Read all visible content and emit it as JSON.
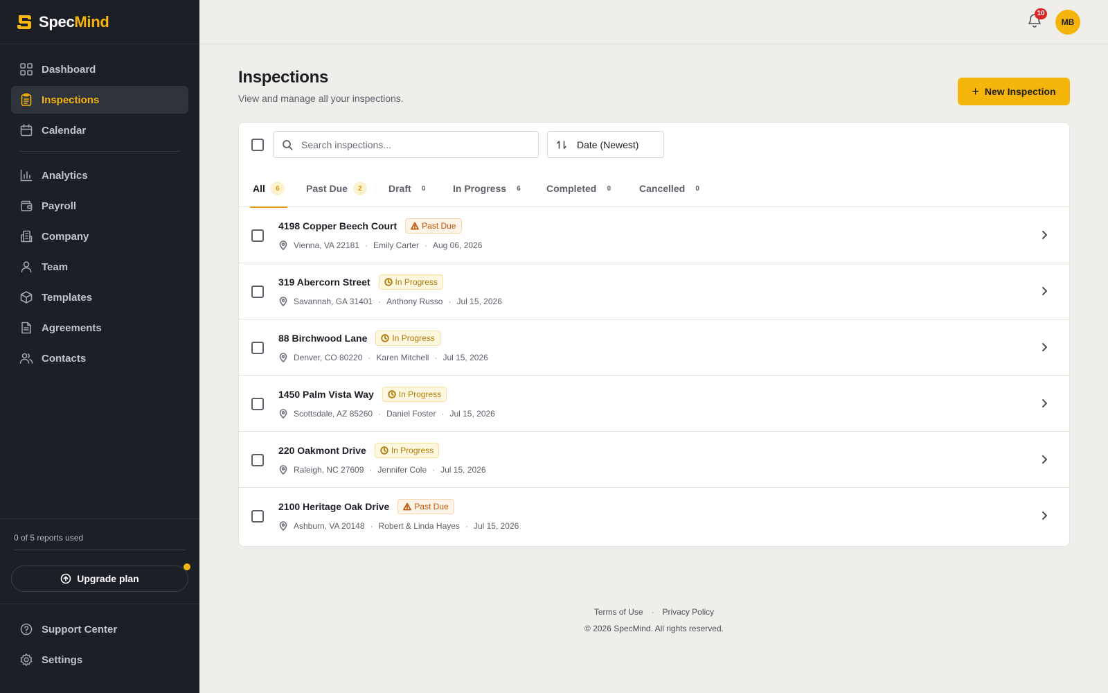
{
  "brand": {
    "name_part1": "Spec",
    "name_part2": "Mind",
    "accent": "#f5b50a"
  },
  "sidebar": {
    "nav_primary": [
      {
        "label": "Dashboard",
        "icon": "grid-icon"
      },
      {
        "label": "Inspections",
        "icon": "clipboard-icon",
        "active": true
      },
      {
        "label": "Calendar",
        "icon": "calendar-icon"
      }
    ],
    "nav_secondary": [
      {
        "label": "Analytics",
        "icon": "bar-chart-icon"
      },
      {
        "label": "Payroll",
        "icon": "wallet-icon"
      },
      {
        "label": "Company",
        "icon": "building-icon"
      },
      {
        "label": "Team",
        "icon": "user-icon"
      },
      {
        "label": "Templates",
        "icon": "package-icon"
      },
      {
        "label": "Agreements",
        "icon": "document-icon"
      },
      {
        "label": "Contacts",
        "icon": "users-icon"
      }
    ],
    "usage": "0 of 5 reports used",
    "upgrade_label": "Upgrade plan",
    "footer_nav": [
      {
        "label": "Support Center",
        "icon": "help-circle-icon"
      },
      {
        "label": "Settings",
        "icon": "gear-icon"
      }
    ]
  },
  "topbar": {
    "notification_count": "10",
    "avatar_initials": "MB"
  },
  "page": {
    "title": "Inspections",
    "subtitle": "View and manage all your inspections.",
    "new_button_label": "New Inspection"
  },
  "toolbar": {
    "search_placeholder": "Search inspections...",
    "sort_label": "Date (Newest)"
  },
  "tabs": [
    {
      "label": "All",
      "count": "6",
      "active": true,
      "highlight": true
    },
    {
      "label": "Past Due",
      "count": "2",
      "highlight": true
    },
    {
      "label": "Draft",
      "count": "0"
    },
    {
      "label": "In Progress",
      "count": "6"
    },
    {
      "label": "Completed",
      "count": "0"
    },
    {
      "label": "Cancelled",
      "count": "0"
    }
  ],
  "inspections": [
    {
      "address": "4198 Copper Beech Court",
      "status": "Past Due",
      "status_type": "past",
      "location": "Vienna, VA 22181",
      "client": "Emily Carter",
      "date": "Aug 06, 2026"
    },
    {
      "address": "319 Abercorn Street",
      "status": "In Progress",
      "status_type": "prog",
      "location": "Savannah, GA 31401",
      "client": "Anthony Russo",
      "date": "Jul 15, 2026"
    },
    {
      "address": "88 Birchwood Lane",
      "status": "In Progress",
      "status_type": "prog",
      "location": "Denver, CO 80220",
      "client": "Karen Mitchell",
      "date": "Jul 15, 2026"
    },
    {
      "address": "1450 Palm Vista Way",
      "status": "In Progress",
      "status_type": "prog",
      "location": "Scottsdale, AZ 85260",
      "client": "Daniel Foster",
      "date": "Jul 15, 2026"
    },
    {
      "address": "220 Oakmont Drive",
      "status": "In Progress",
      "status_type": "prog",
      "location": "Raleigh, NC 27609",
      "client": "Jennifer Cole",
      "date": "Jul 15, 2026"
    },
    {
      "address": "2100 Heritage Oak Drive",
      "status": "Past Due",
      "status_type": "past",
      "location": "Ashburn, VA 20148",
      "client": "Robert & Linda Hayes",
      "date": "Jul 15, 2026"
    }
  ],
  "footer": {
    "terms_label": "Terms of Use",
    "privacy_label": "Privacy Policy",
    "separator": "·",
    "copyright": "© 2026 SpecMind. All rights reserved."
  }
}
